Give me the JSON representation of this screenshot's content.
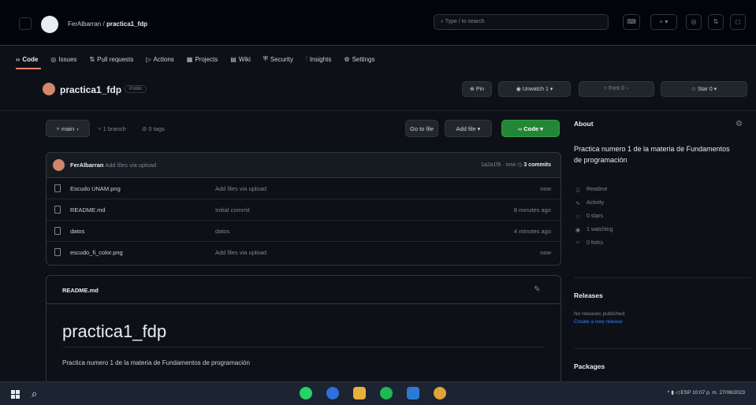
{
  "header": {
    "owner": "FerAlbarran",
    "separator": "/",
    "repo": "practica1_fdp",
    "search_placeholder": "Type / to search",
    "icons": [
      "menu-icon",
      "github-logo-icon",
      "terminal-icon",
      "plus-icon",
      "issues-icon",
      "pull-requests-icon",
      "inbox-icon"
    ]
  },
  "tabs": [
    {
      "label": "Code",
      "icon": "code-icon",
      "selected": true
    },
    {
      "label": "Issues",
      "icon": "issue-icon"
    },
    {
      "label": "Pull requests",
      "icon": "pull-request-icon"
    },
    {
      "label": "Actions",
      "icon": "actions-icon"
    },
    {
      "label": "Projects",
      "icon": "projects-icon"
    },
    {
      "label": "Wiki",
      "icon": "wiki-icon"
    },
    {
      "label": "Security",
      "icon": "shield-icon"
    },
    {
      "label": "Insights",
      "icon": "graph-icon"
    },
    {
      "label": "Settings",
      "icon": "gear-icon"
    }
  ],
  "repo": {
    "name": "practica1_fdp",
    "visibility": "Public",
    "pin": "Pin",
    "unwatch": "Unwatch",
    "watch_count": "1",
    "fork": "Fork",
    "fork_count": "0",
    "star": "Star",
    "star_count": "0"
  },
  "branch_bar": {
    "branch": "main",
    "branches": "1 branch",
    "tags": "0 tags",
    "goto_file": "Go to file",
    "add_file": "Add file",
    "code": "Code"
  },
  "commit": {
    "author": "FerAlbarran",
    "message": "Add files via upload",
    "hash": "1a2a1f9 · now",
    "commits": "3 commits"
  },
  "files": [
    {
      "name": "Escudo UNAM.png",
      "message": "Add files via upload",
      "time": "now"
    },
    {
      "name": "README.md",
      "message": "Initial commit",
      "time": "8 minutes ago"
    },
    {
      "name": "datos",
      "message": "datos",
      "time": "4 minutes ago"
    },
    {
      "name": "escudo_fi_color.png",
      "message": "Add files via upload",
      "time": "now"
    }
  ],
  "readme": {
    "file": "README.md",
    "heading": "practica1_fdp",
    "body": "Practica numero 1 de la materia de Fundamentos de programación"
  },
  "about": {
    "title": "About",
    "description": "Practica numero 1 de la materia de Fundamentos de programación",
    "items": [
      {
        "label": "Readme",
        "icon": "book-icon"
      },
      {
        "label": "Activity",
        "icon": "pulse-icon"
      },
      {
        "label": "0 stars",
        "icon": "star-icon"
      },
      {
        "label": "1 watching",
        "icon": "eye-icon"
      },
      {
        "label": "0 forks",
        "icon": "fork-icon"
      }
    ]
  },
  "releases": {
    "title": "Releases",
    "none": "No releases published",
    "create": "Create a new release"
  },
  "packages": {
    "title": "Packages"
  },
  "taskbar": {
    "tray_text": "ESP",
    "time": "10:07 p. m.",
    "date": "27/08/2023"
  }
}
